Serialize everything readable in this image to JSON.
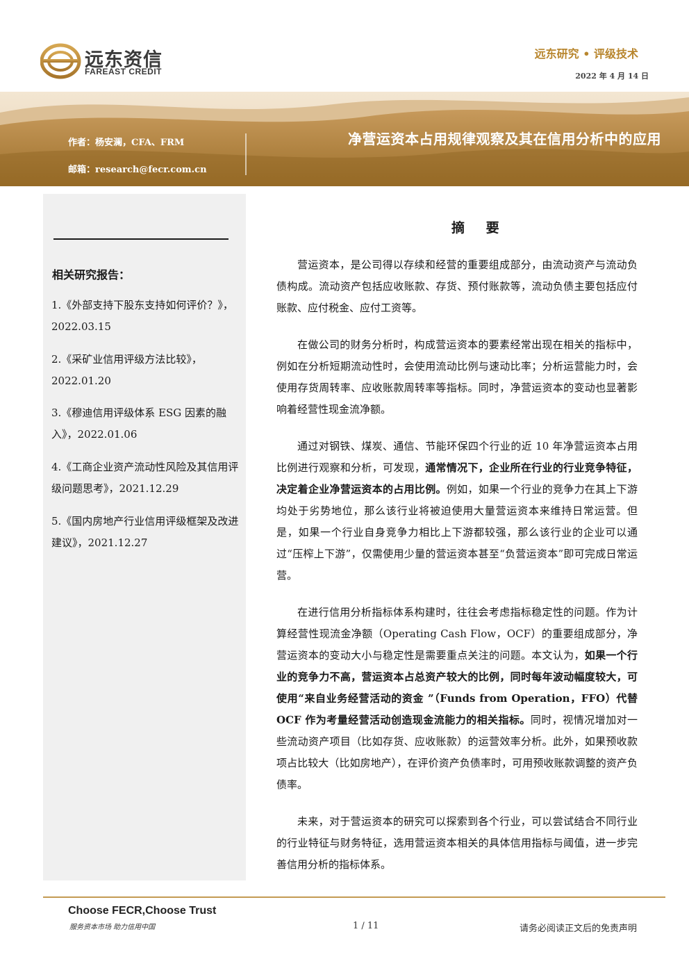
{
  "header": {
    "logo_cn": "远东资信",
    "logo_en": "FAREAST CREDIT",
    "series": "远东研究 • 评级技术",
    "date": "2022 年 4 月 14 日"
  },
  "banner": {
    "author": "作者：杨安澜，CFA、FRM",
    "email": "邮箱：research@fecr.com.cn",
    "title": "净营运资本占用规律观察及其在信用分析中的应用"
  },
  "sidebar": {
    "heading": "相关研究报告：",
    "reports": [
      "1.《外部支持下股东支持如何评价？》，2022.03.15",
      "2.《采矿业信用评级方法比较》，2022.01.20",
      "3.《穆迪信用评级体系 ESG 因素的融入》，2022.01.06",
      "4.《工商企业资产流动性风险及其信用评级问题思考》，2021.12.29",
      "5.《国内房地产行业信用评级框架及改进建议》，2021.12.27"
    ]
  },
  "abstract": {
    "heading": "摘 要",
    "p1": "营运资本，是公司得以存续和经营的重要组成部分，由流动资产与流动负债构成。流动资产包括应收账款、存货、预付账款等，流动负债主要包括应付账款、应付税金、应付工资等。",
    "p2": "在做公司的财务分析时，构成营运资本的要素经常出现在相关的指标中，例如在分析短期流动性时，会使用流动比例与速动比率；分析运营能力时，会使用存货周转率、应收账款周转率等指标。同时，净营运资本的变动也显著影响着经营性现金流净额。",
    "p3a": "通过对钢铁、煤炭、通信、节能环保四个行业的近 10 年净营运资本占用比例进行观察和分析，可发现，",
    "p3b": "通常情况下，企业所在行业的行业竞争特征，决定着企业净营运资本的占用比例。",
    "p3c": "例如，如果一个行业的竞争力在其上下游均处于劣势地位，那么该行业将被迫使用大量营运资本来维持日常运营。但是，如果一个行业自身竞争力相比上下游都较强，那么该行业的企业可以通过“压榨上下游”，仅需使用少量的营运资本甚至“负营运资本”即可完成日常运营。",
    "p4a": "在进行信用分析指标体系构建时，往往会考虑指标稳定性的问题。作为计算经营性现流金净额（Operating Cash Flow，OCF）的重要组成部分，净营运资本的变动大小与稳定性是需要重点关注的问题。本文认为，",
    "p4b": "如果一个行业的竞争力不高，营运资本占总资产较大的比例，同时每年波动幅度较大，可使用“来自业务经营活动的资金 ”（Funds from Operation，FFO）代替 OCF 作为考量经营活动创造现金流能力的相关指标。",
    "p4c": "同时，视情况增加对一些流动资产项目（比如存货、应收账款）的运营效率分析。此外，如果预收款项占比较大（比如房地产），在评价资产负债率时，可用预收账款调整的资产负债率。",
    "p5": "未来，对于营运资本的研究可以探索到各个行业，可以尝试结合不同行业的行业特征与财务特征，选用营运资本相关的具体信用指标与阈值，进一步完善信用分析的指标体系。"
  },
  "footer": {
    "slogan_en": "Choose FECR,Choose Trust",
    "slogan_cn": "服务资本市场 助力信用中国",
    "page": "1 / 11",
    "disclaimer": "请务必阅读正文后的免责声明"
  },
  "colors": {
    "gold": "#b8862e",
    "gold_dark": "#9c6f2a",
    "sidebar_bg": "#f0f0f0"
  }
}
